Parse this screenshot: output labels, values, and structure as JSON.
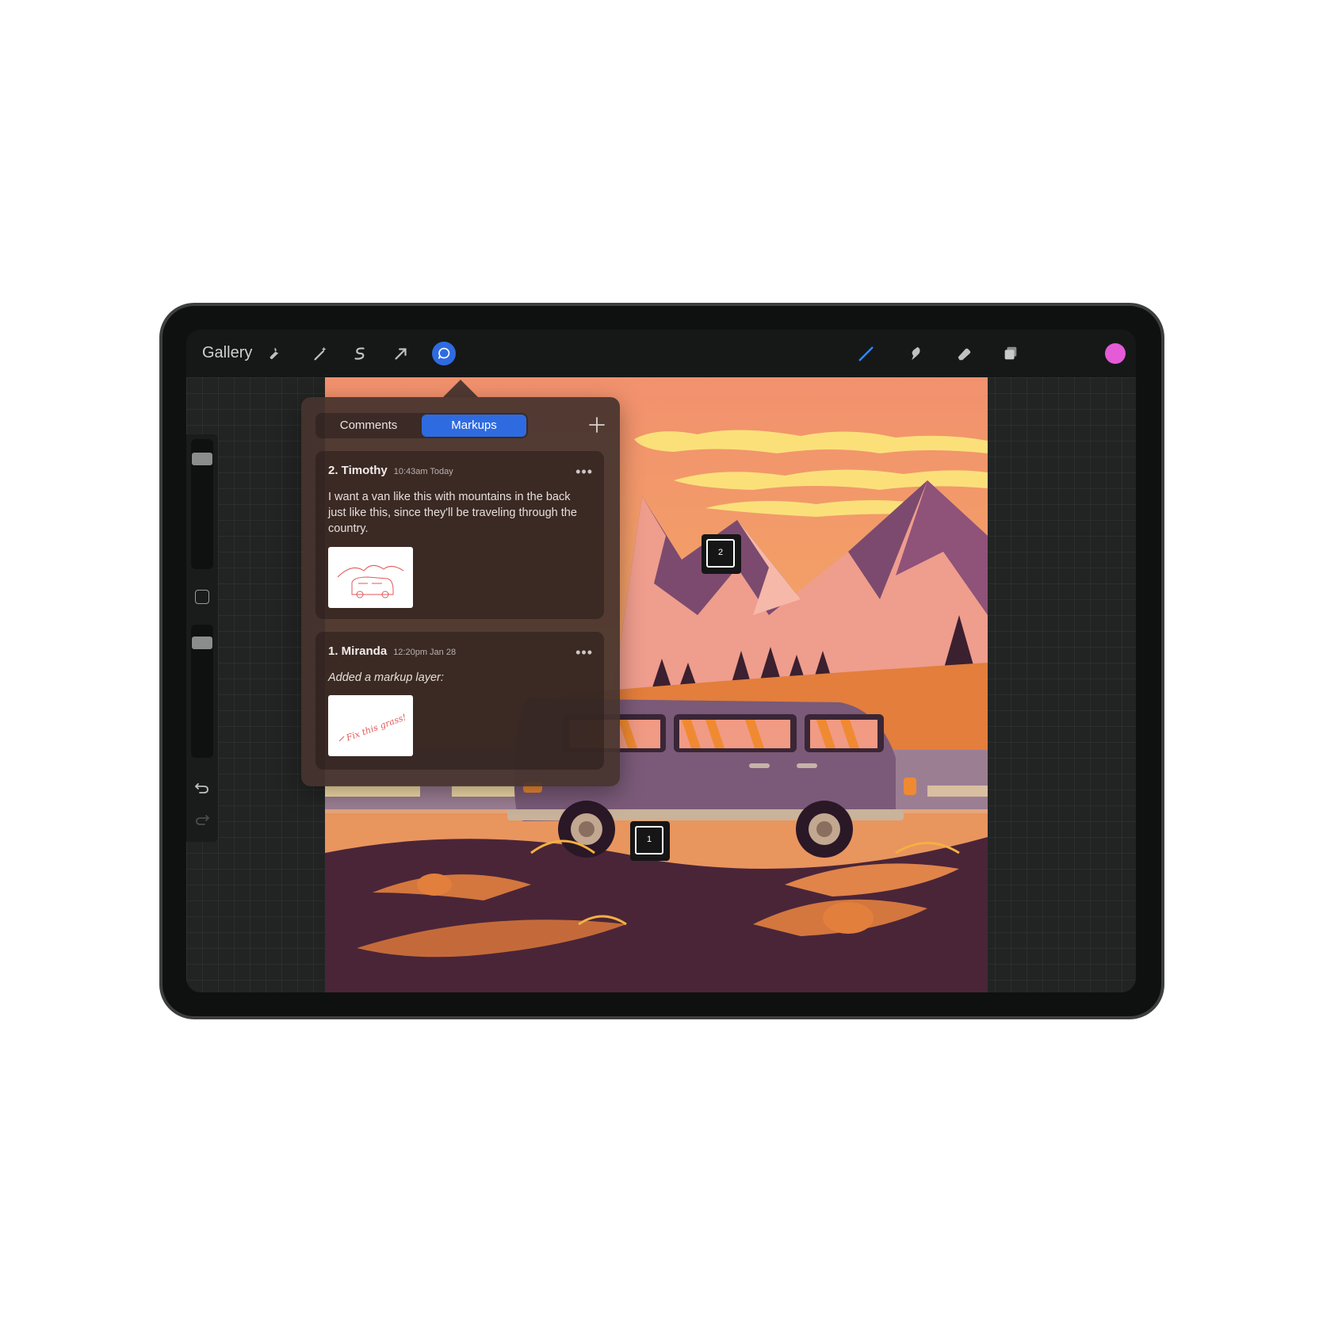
{
  "toolbar": {
    "gallery_label": "Gallery",
    "left_icons": [
      "wrench-icon",
      "magic-wand-icon",
      "selection-icon",
      "transform-arrow-icon",
      "comments-bubble-icon"
    ],
    "right_icons": [
      "brush-icon",
      "smudge-icon",
      "eraser-icon",
      "layers-icon"
    ],
    "active_icon": "comments-bubble-icon",
    "current_color": "#e55ad6",
    "accent_color": "#2f6be0"
  },
  "sidebar": {
    "brush_size": 0.15,
    "opacity": 0.1,
    "icons": [
      "modify-square-icon",
      "undo-icon",
      "redo-icon"
    ]
  },
  "popover": {
    "tabs": [
      {
        "label": "Comments",
        "active": false
      },
      {
        "label": "Markups",
        "active": true
      }
    ],
    "add_icon": "plus-icon",
    "cards": [
      {
        "name": "2. Timothy",
        "time": "10:43am Today",
        "body": "I want a van like this with mountains in the back just like this, since they'll be traveling through the country.",
        "more_icon": "more-dots-icon"
      },
      {
        "name": "1. Miranda",
        "time": "12:20pm Jan 28",
        "body": "Added a markup layer:",
        "more_icon": "more-dots-icon",
        "thumbnail_text": "Fix this grass!"
      }
    ]
  },
  "markers": [
    {
      "number": "2"
    },
    {
      "number": "1"
    }
  ]
}
